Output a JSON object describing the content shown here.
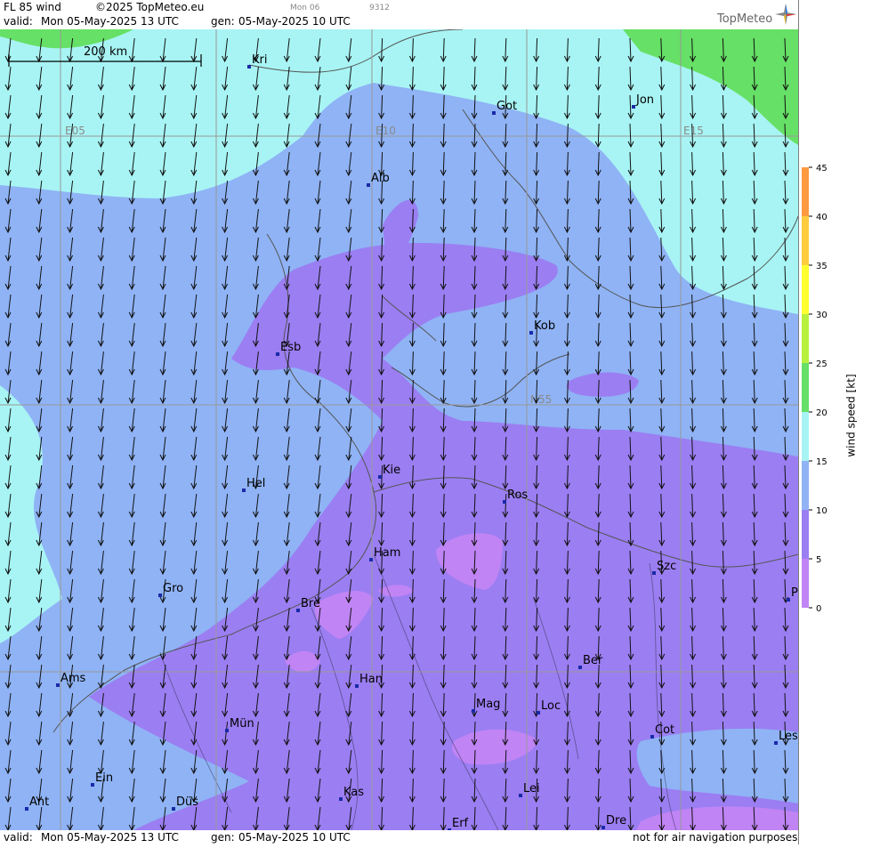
{
  "header": {
    "product": "FL 85 wind",
    "copyright": "©2025 TopMeteo.eu",
    "valid_label": "valid:",
    "valid_value": "Mon  05-May-2025  13 UTC",
    "gen_label": "gen:",
    "gen_value": "05-May-2025 10 UTC",
    "slider_day": "Mon 06",
    "slider_code": "9312",
    "brand": "TopMeteo"
  },
  "footer": {
    "valid_label": "valid:",
    "valid_value": "Mon  05-May-2025  13 UTC",
    "gen_label": "gen:",
    "gen_value": "05-May-2025 10 UTC",
    "disclaimer": "not for air navigation purposes"
  },
  "scale": {
    "label": "200 km"
  },
  "grid_labels": [
    "E05",
    "E10",
    "E15",
    "N55"
  ],
  "cities": [
    "Kri",
    "Got",
    "Jon",
    "Alb",
    "Kob",
    "Esb",
    "Kie",
    "Hel",
    "Ros",
    "Ham",
    "Szc",
    "Gro",
    "Bre",
    "Pi",
    "Ber",
    "Ams",
    "Han",
    "Mag",
    "Loc",
    "Mün",
    "Cot",
    "Les",
    "Ein",
    "Lei",
    "Kas",
    "Ant",
    "Düs",
    "Dre",
    "Erf"
  ],
  "legend": {
    "title": "wind speed [kt]",
    "ticks": [
      "45",
      "40",
      "35",
      "30",
      "25",
      "20",
      "15",
      "10",
      "5",
      "0"
    ],
    "colors": {
      "0": "#c084f5",
      "5": "#9b7ef2",
      "10": "#8fb3f5",
      "15": "#a8f4f4",
      "20": "#66e066",
      "25": "#b8f040",
      "30": "#ffff30",
      "35": "#ffcc40",
      "40": "#ff9a40",
      "45": "#f07050"
    }
  }
}
